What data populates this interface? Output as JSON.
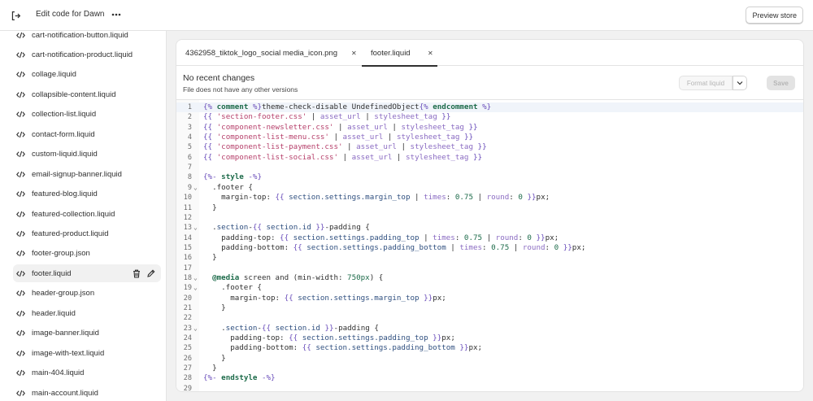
{
  "header": {
    "title": "Edit code for Dawn",
    "preview_label": "Preview store"
  },
  "sidebar": {
    "files": [
      {
        "name": "cart-notification-button.liquid"
      },
      {
        "name": "cart-notification-product.liquid"
      },
      {
        "name": "collage.liquid"
      },
      {
        "name": "collapsible-content.liquid"
      },
      {
        "name": "collection-list.liquid"
      },
      {
        "name": "contact-form.liquid"
      },
      {
        "name": "custom-liquid.liquid"
      },
      {
        "name": "email-signup-banner.liquid"
      },
      {
        "name": "featured-blog.liquid"
      },
      {
        "name": "featured-collection.liquid"
      },
      {
        "name": "featured-product.liquid"
      },
      {
        "name": "footer-group.json"
      },
      {
        "name": "footer.liquid",
        "active": true
      },
      {
        "name": "header-group.json"
      },
      {
        "name": "header.liquid"
      },
      {
        "name": "image-banner.liquid"
      },
      {
        "name": "image-with-text.liquid"
      },
      {
        "name": "main-404.liquid"
      },
      {
        "name": "main-account.liquid"
      }
    ]
  },
  "editor": {
    "tabs": [
      {
        "label": "4362958_tiktok_logo_social media_icon.png",
        "active": false
      },
      {
        "label": "footer.liquid",
        "active": true
      }
    ],
    "info_title": "No recent changes",
    "info_subtitle": "File does not have any other versions",
    "format_label": "Format liquid",
    "save_label": "Save",
    "lines": [
      "{% comment %}theme-check-disable UndefinedObject{% endcomment %}",
      "{{ 'section-footer.css' | asset_url | stylesheet_tag }}",
      "{{ 'component-newsletter.css' | asset_url | stylesheet_tag }}",
      "{{ 'component-list-menu.css' | asset_url | stylesheet_tag }}",
      "{{ 'component-list-payment.css' | asset_url | stylesheet_tag }}",
      "{{ 'component-list-social.css' | asset_url | stylesheet_tag }}",
      "",
      "{%- style -%}",
      "  .footer {",
      "    margin-top: {{ section.settings.margin_top | times: 0.75 | round: 0 }}px;",
      "  }",
      "",
      "  .section-{{ section.id }}-padding {",
      "    padding-top: {{ section.settings.padding_top | times: 0.75 | round: 0 }}px;",
      "    padding-bottom: {{ section.settings.padding_bottom | times: 0.75 | round: 0 }}px;",
      "  }",
      "",
      "  @media screen and (min-width: 750px) {",
      "    .footer {",
      "      margin-top: {{ section.settings.margin_top }}px;",
      "    }",
      "",
      "    .section-{{ section.id }}-padding {",
      "      padding-top: {{ section.settings.padding_top }}px;",
      "      padding-bottom: {{ section.settings.padding_bottom }}px;",
      "    }",
      "  }",
      "{%- endstyle -%}",
      ""
    ],
    "fold_lines": [
      9,
      13,
      18,
      19,
      23
    ],
    "current_line": 1
  },
  "icons": {
    "exit": "exit-icon",
    "more": "more-horizontal-icon",
    "file": "code-file-icon",
    "delete": "trash-icon",
    "rename": "pencil-icon",
    "close": "close-icon",
    "dropdown": "chevron-down-icon",
    "fold": "chevron-down-icon"
  },
  "colors": {
    "liquid_tag": "#6b4fbb",
    "string": "#b6406b",
    "filter": "#8a6bc2",
    "number": "#1d6b4a"
  }
}
